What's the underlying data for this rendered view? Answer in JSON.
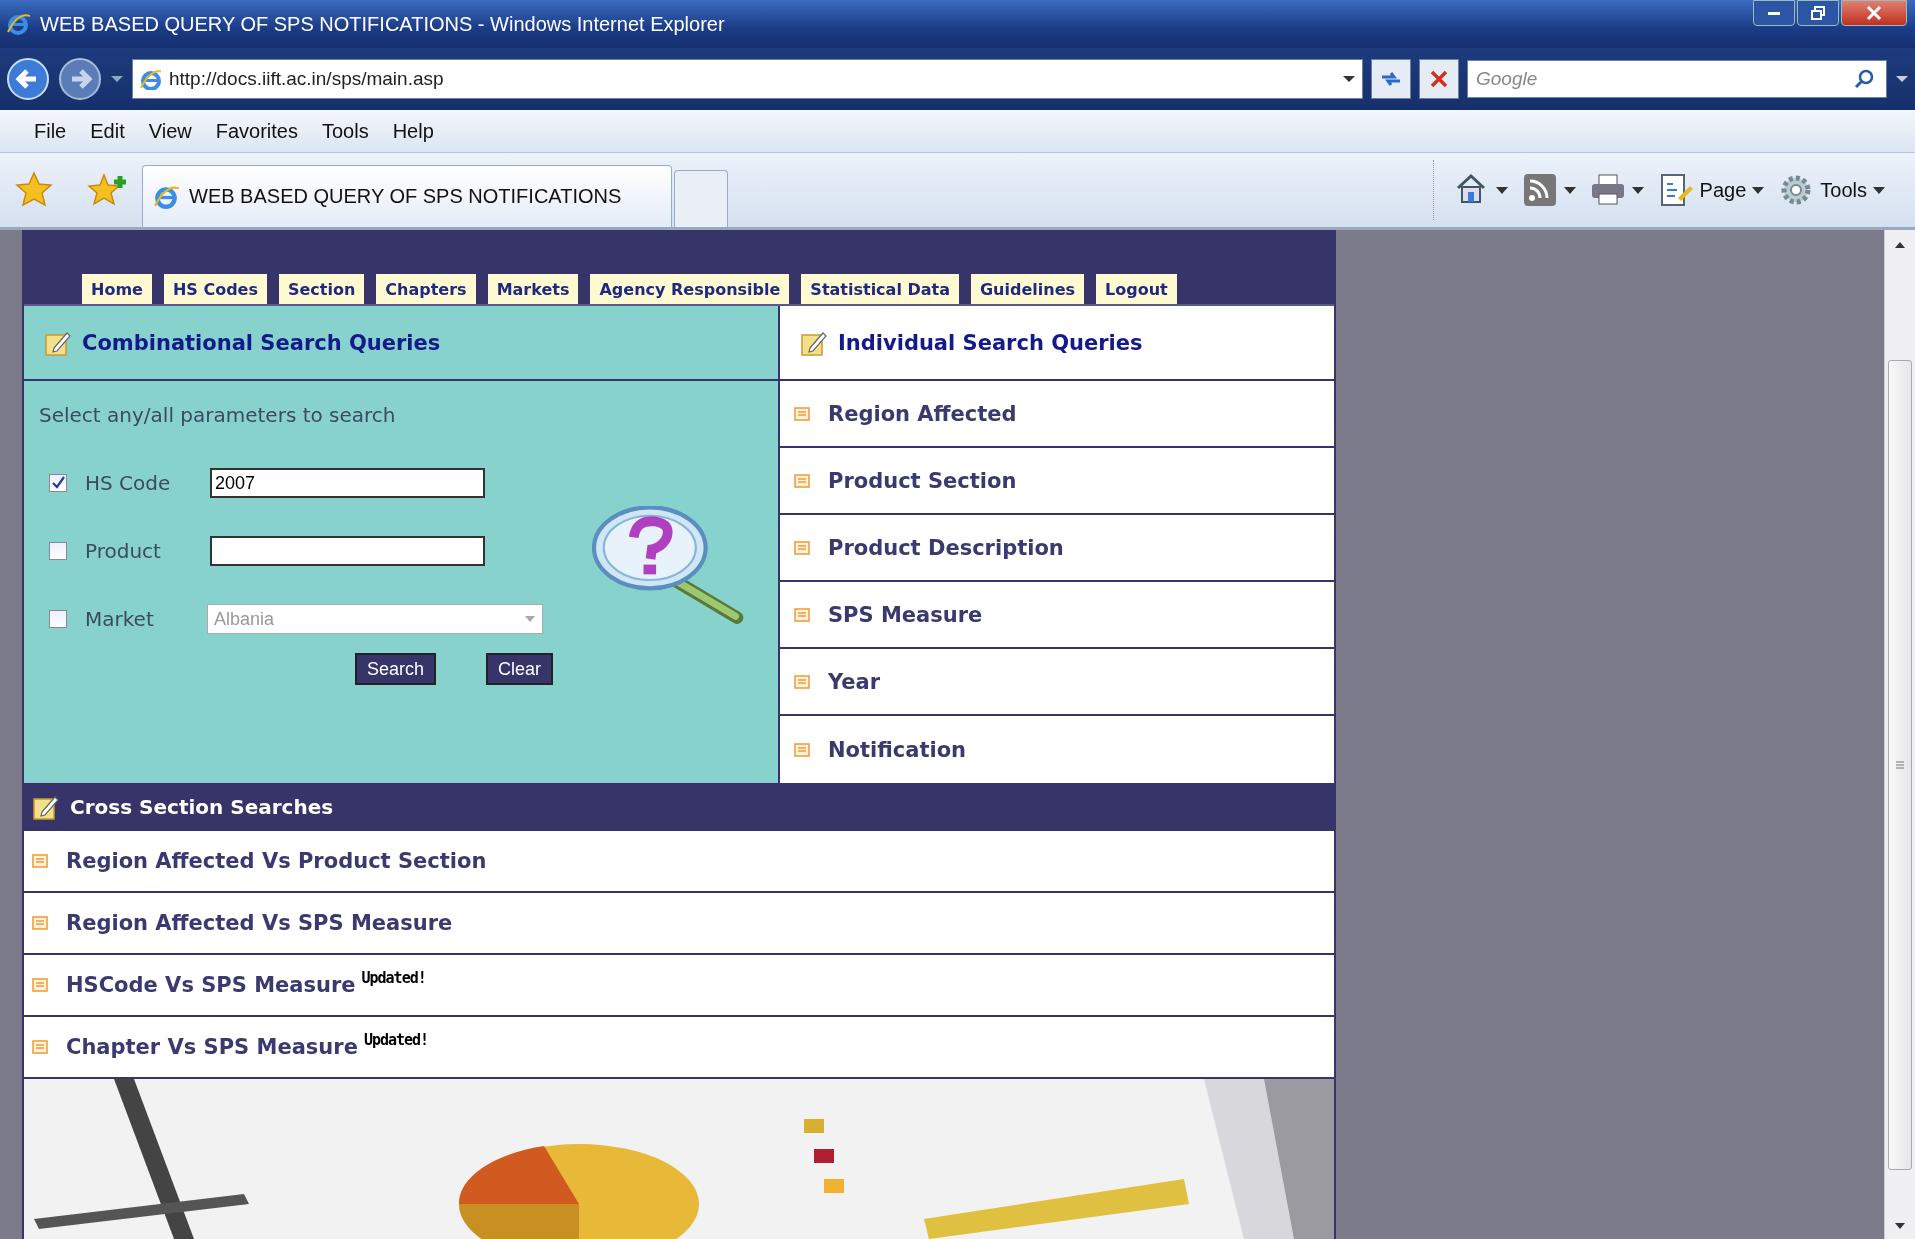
{
  "window": {
    "title": "WEB BASED QUERY OF SPS NOTIFICATIONS - Windows Internet Explorer"
  },
  "address_bar": {
    "url": "http://docs.iift.ac.in/sps/main.asp"
  },
  "search_box": {
    "placeholder": "Google"
  },
  "menu": [
    "File",
    "Edit",
    "View",
    "Favorites",
    "Tools",
    "Help"
  ],
  "browser_tab": {
    "title": "WEB BASED QUERY OF SPS NOTIFICATIONS"
  },
  "command_bar": [
    {
      "kind": "home"
    },
    {
      "kind": "feeds"
    },
    {
      "kind": "print"
    },
    {
      "kind": "page",
      "label": "Page"
    },
    {
      "kind": "tools",
      "label": "Tools"
    }
  ],
  "nav_tabs": [
    "Home",
    "HS Codes",
    "Section",
    "Chapters",
    "Markets",
    "Agency Responsible",
    "Statistical Data",
    "Guidelines",
    "Logout"
  ],
  "combinational": {
    "title": "Combinational Search Queries",
    "hint": "Select any/all parameters to search",
    "fields": [
      {
        "kind": "text",
        "label": "HS Code",
        "checked": true,
        "value": "2007"
      },
      {
        "kind": "text",
        "label": "Product",
        "checked": false
      },
      {
        "kind": "select",
        "label": "Market",
        "checked": false,
        "value": "Albania",
        "disabled": true
      }
    ],
    "buttons": [
      "Search",
      "Clear"
    ]
  },
  "individual": {
    "title": "Individual Search Queries",
    "items": [
      "Region Affected",
      "Product Section",
      "Product Description",
      "SPS Measure",
      "Year",
      "Notification"
    ]
  },
  "cross_section": {
    "title": "Cross Section Searches",
    "items": [
      {
        "label": "Region Affected Vs Product Section"
      },
      {
        "label": "Region Affected Vs SPS Measure"
      },
      {
        "label": "HSCode Vs SPS Measure",
        "badge": "Updated!"
      },
      {
        "label": "Chapter Vs SPS Measure",
        "badge": "Updated!"
      }
    ]
  }
}
